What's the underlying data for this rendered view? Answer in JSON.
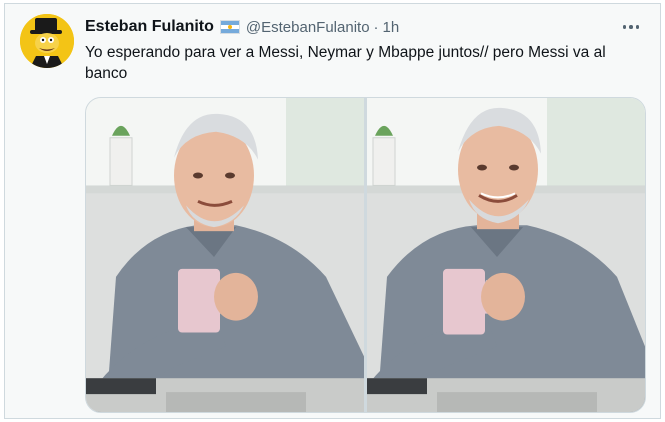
{
  "tweet": {
    "display_name": "Esteban Fulanito",
    "flag_icon": "argentina-flag-icon",
    "handle": "@EstebanFulanito",
    "separator": "·",
    "timestamp": "1h",
    "more_icon": "more-options-icon",
    "text": "Yo esperando para ver a Messi, Neymar y Mbappe juntos// pero Messi va al banco",
    "avatar_icon": "top-hat-cartoon-avatar",
    "media": [
      {
        "alt": "meme-photo-left"
      },
      {
        "alt": "meme-photo-right"
      }
    ]
  },
  "colors": {
    "background": "#f7f9f9",
    "border": "#cfd9de",
    "secondary_text": "#536471",
    "avatar_bg": "#f1c40f"
  }
}
